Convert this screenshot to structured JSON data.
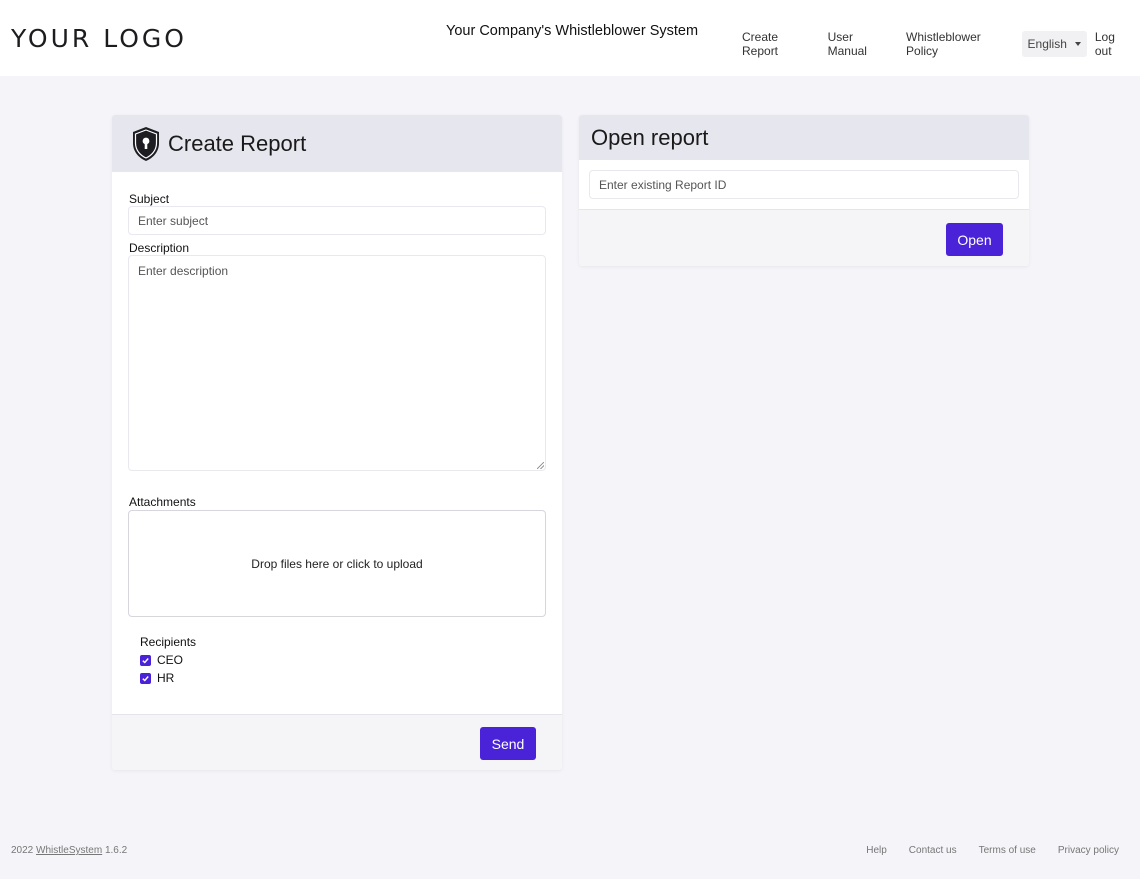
{
  "header": {
    "logo": "YOUR LOGO",
    "title": "Your Company's Whistleblower System",
    "nav": [
      "Create Report",
      "User Manual",
      "Whistleblower Policy"
    ],
    "language": "English",
    "logout": "Log out"
  },
  "create_report": {
    "title": "Create Report",
    "icon": "shield-lock-icon",
    "subject_label": "Subject",
    "subject_placeholder": "Enter subject",
    "description_label": "Description",
    "description_placeholder": "Enter description",
    "attachments_label": "Attachments",
    "dropzone_text": "Drop files here or click to upload",
    "recipients_label": "Recipients",
    "recipients": [
      {
        "label": "CEO",
        "checked": true
      },
      {
        "label": "HR",
        "checked": true
      }
    ],
    "send_label": "Send"
  },
  "open_report": {
    "title": "Open report",
    "id_placeholder": "Enter existing Report ID",
    "open_label": "Open"
  },
  "footer": {
    "year": "2022",
    "brand": "WhistleSystem",
    "version": "1.6.2",
    "links": [
      "Help",
      "Contact us",
      "Terms of use",
      "Privacy policy"
    ]
  },
  "colors": {
    "accent": "#4a22d8",
    "background": "#f4f4f9",
    "card_header": "#e6e6ef"
  }
}
